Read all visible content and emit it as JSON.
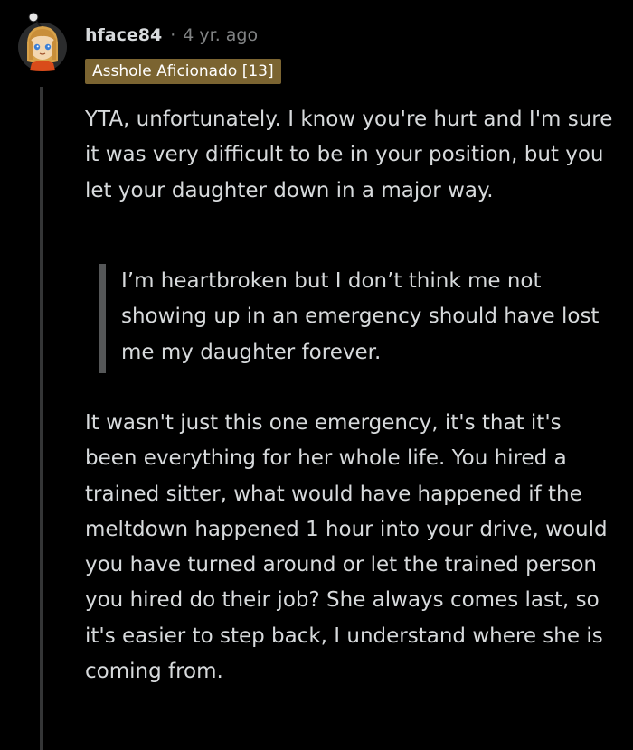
{
  "comment": {
    "author": "hface84",
    "separator": "·",
    "timestamp": "4 yr. ago",
    "flair": "Asshole Aficionado [13]",
    "paragraph_1": "YTA, unfortunately. I know you're hurt and I'm sure it was very difficult to be in your position, but you let your daughter down in a major way.",
    "blockquote": "I’m heartbroken but I don’t think me not showing up in an emergency should have lost me my daughter forever.",
    "paragraph_2": "It wasn't just this one emergency, it's that it's been everything for her whole life. You hired a trained sitter, what would have happened if the meltdown happened 1 hour into your drive, would you have turned around or let the trained person you hired do their job? She always comes last, so it's easier to step back, I understand where she is coming from."
  },
  "colors": {
    "background": "#000000",
    "text": "#d7dadc",
    "meta": "#818384",
    "flair_bg": "#7b6431",
    "thread_line": "#343536",
    "quote_bar": "#555758"
  },
  "icons": {
    "avatar": "snoo-avatar-icon"
  }
}
